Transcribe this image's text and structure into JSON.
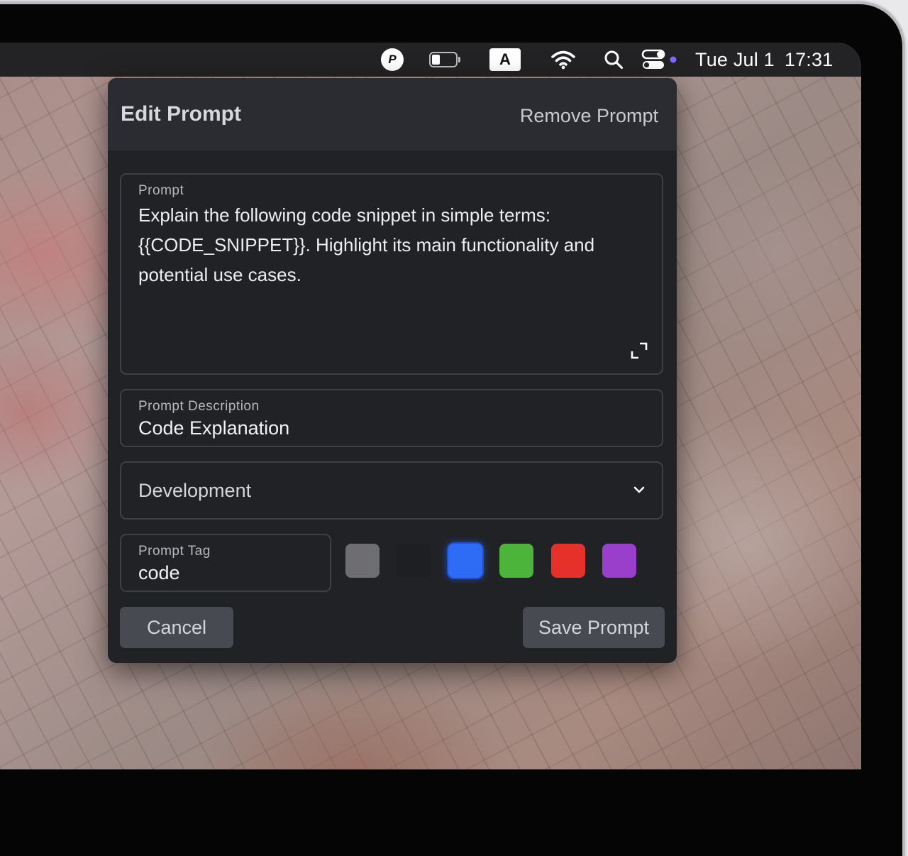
{
  "menubar": {
    "status_icon_letter": "P",
    "battery_level": 0.35,
    "input_source_letter": "A",
    "date": "Tue Jul 1",
    "time": "17:31",
    "icons": [
      "p-app-icon",
      "battery-icon",
      "input-source-icon",
      "wifi-icon",
      "search-icon",
      "control-center-icon"
    ]
  },
  "dialog": {
    "title": "Edit Prompt",
    "remove_label": "Remove Prompt",
    "prompt": {
      "label": "Prompt",
      "value": "Explain the following code snippet in simple terms: {{CODE_SNIPPET}}. Highlight its main functionality and potential use cases."
    },
    "description": {
      "label": "Prompt Description",
      "value": "Code Explanation"
    },
    "category": {
      "selected": "Development"
    },
    "tag": {
      "label": "Prompt Tag",
      "value": "code"
    },
    "colors": [
      {
        "name": "gray",
        "hex": "#6e6e72",
        "selected": false
      },
      {
        "name": "black",
        "hex": "#1e1f22",
        "selected": false
      },
      {
        "name": "blue",
        "hex": "#2f6cf5",
        "selected": true
      },
      {
        "name": "green",
        "hex": "#4cb43a",
        "selected": false
      },
      {
        "name": "red",
        "hex": "#e6302a",
        "selected": false
      },
      {
        "name": "purple",
        "hex": "#9a3fcb",
        "selected": false
      }
    ],
    "cancel_label": "Cancel",
    "save_label": "Save Prompt"
  }
}
